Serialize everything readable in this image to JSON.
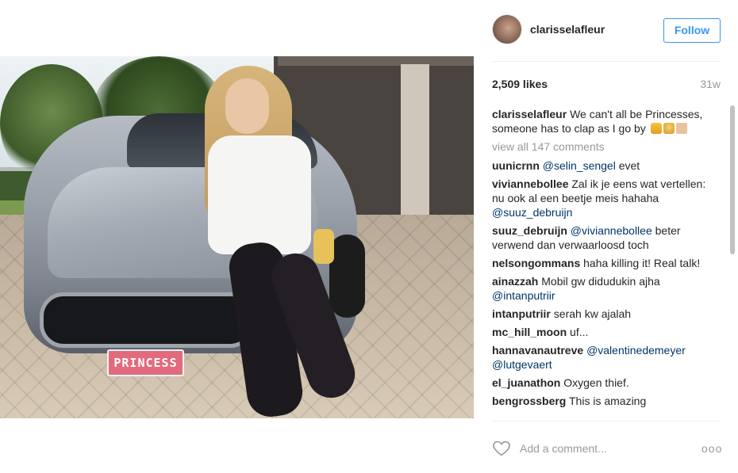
{
  "post": {
    "plate_text": "PRINCESS",
    "username": "clarisselafleur",
    "follow_label": "Follow",
    "likes": "2,509 likes",
    "age": "31w",
    "caption_user": "clarisselafleur",
    "caption_text": "We can't all be Princesses, someone has to clap as I go by",
    "view_all": "view all 147 comments",
    "add_comment_placeholder": "Add a comment...",
    "more_label": "ooo"
  },
  "comments": [
    {
      "user": "uunicrnn",
      "mention": "@selin_sengel",
      "text": " evet"
    },
    {
      "user": "viviannebollee",
      "text": "Zal ik je eens wat vertellen: nu ook al een beetje meis hahaha ",
      "mention_end": "@suuz_debruijn"
    },
    {
      "user": "suuz_debruijn",
      "mention": "@viviannebollee",
      "text": " beter verwend dan verwaarloosd toch"
    },
    {
      "user": "nelsongommans",
      "text": "haha killing it! Real talk!"
    },
    {
      "user": "ainazzah",
      "text": "Mobil gw didudukin ajha ",
      "mention_end": "@intanputriir"
    },
    {
      "user": "intanputriir",
      "text": "serah kw ajalah"
    },
    {
      "user": "mc_hill_moon",
      "text": "uf..."
    },
    {
      "user": "hannavanautreve",
      "mention": "@valentinedemeyer",
      "text": " ",
      "mention_end": "@lutgevaert"
    },
    {
      "user": "el_juanathon",
      "text": "Oxygen thief."
    },
    {
      "user": "bengrossberg",
      "text": "This is amazing"
    }
  ],
  "icons": {
    "heart": "heart-outline-icon",
    "more": "more-dots-icon",
    "avatar": "user-avatar"
  },
  "colors": {
    "accent": "#3897f0",
    "mention": "#003569",
    "muted": "#999999"
  }
}
